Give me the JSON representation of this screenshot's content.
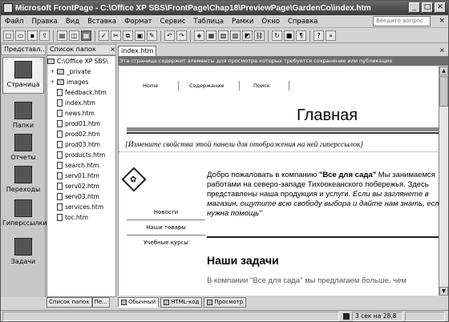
{
  "window": {
    "title": "Microsoft FrontPage - C:\\Office XP SBS\\FrontPage\\Chap18\\PreviewPage\\GardenCo\\index.htm",
    "min_label": "_",
    "max_label": "□",
    "close_label": "✕"
  },
  "menu": {
    "items": [
      "Файл",
      "Правка",
      "Вид",
      "Вставка",
      "Формат",
      "Сервис",
      "Таблица",
      "Рамки",
      "Окно",
      "Справка"
    ],
    "ask_placeholder": "Введите вопрос",
    "close_label": "×"
  },
  "views": {
    "title": "Представл...",
    "items": [
      {
        "label": "Страница",
        "icon": "page-view-icon"
      },
      {
        "label": "Папки",
        "icon": "folders-view-icon"
      },
      {
        "label": "Отчеты",
        "icon": "reports-view-icon"
      },
      {
        "label": "Переходы",
        "icon": "navigation-view-icon"
      },
      {
        "label": "Гиперссылки",
        "icon": "hyperlinks-view-icon"
      },
      {
        "label": "Задачи",
        "icon": "tasks-view-icon"
      }
    ]
  },
  "folders": {
    "title": "Список папок",
    "close_label": "×",
    "root": "C:\\Office XP SBS\\",
    "folders": [
      "_private",
      "images"
    ],
    "files": [
      "feedback.htm",
      "index.htm",
      "news.htm",
      "prod01.htm",
      "prod02.htm",
      "prod03.htm",
      "products.htm",
      "search.htm",
      "serv01.htm",
      "serv02.htm",
      "serv03.htm",
      "services.htm",
      "toc.htm"
    ]
  },
  "document": {
    "tab_label": "index.htm",
    "close_label": "×",
    "infobar": "Эта страница содержит элементы для просмотра которых требуется сохранение или публикация",
    "nav": [
      "Home",
      "Содержание",
      "Поиск"
    ],
    "title": "Главная",
    "banner_text": "[Измените свойства этой панели для отображения на ней гиперссылок]",
    "left_nav": [
      "Новости",
      "Наши товары",
      "Учебные курсы"
    ],
    "welcome_prefix": "Добро пожаловать в компанию ",
    "welcome_brand": "\"Все для сада\"",
    "welcome_rest": " Мы занимаемся",
    "welcome_line2": "работами на северо-западе Тихоокеанского побережья. Здесь",
    "welcome_line3": "представлены наша продукция и услуги. ",
    "welcome_line3_em": "Если вы заглянете в",
    "welcome_line4_em": "магазин, ощутите всю свободу выбора и дайте нам знать, если",
    "welcome_line5_em": "нужна помощь\"",
    "heading": "Наши задачи",
    "last_line": "В компании \"Все для сада\" мы предлагаем больше, чем"
  },
  "panel_tabs": [
    "Список папок",
    "Пе..."
  ],
  "view_tabs": [
    "Обычный",
    "HTML-код",
    "Просмотр"
  ],
  "status": {
    "download_time": "3 сек на 28,8"
  }
}
